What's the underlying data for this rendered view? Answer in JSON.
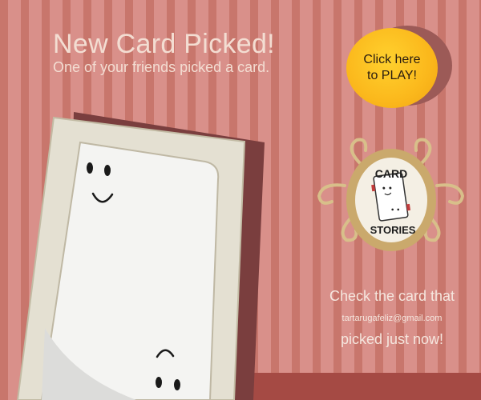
{
  "headline": {
    "title": "New Card Picked!",
    "subtitle": "One of your friends picked a card."
  },
  "play_button": {
    "line1": "Click here",
    "line2": "to PLAY!"
  },
  "logo": {
    "line1": "CARD",
    "line2": "STORIES"
  },
  "info": {
    "line1": "Check the card that",
    "email": "tartarugafeliz@gmail.com",
    "line2": "picked just now!"
  },
  "colors": {
    "stripe_dark": "#c8766c",
    "stripe_light": "#d9908a",
    "floor": "#a54a44",
    "button": "#fbb81c",
    "text": "#f3ddd2"
  }
}
